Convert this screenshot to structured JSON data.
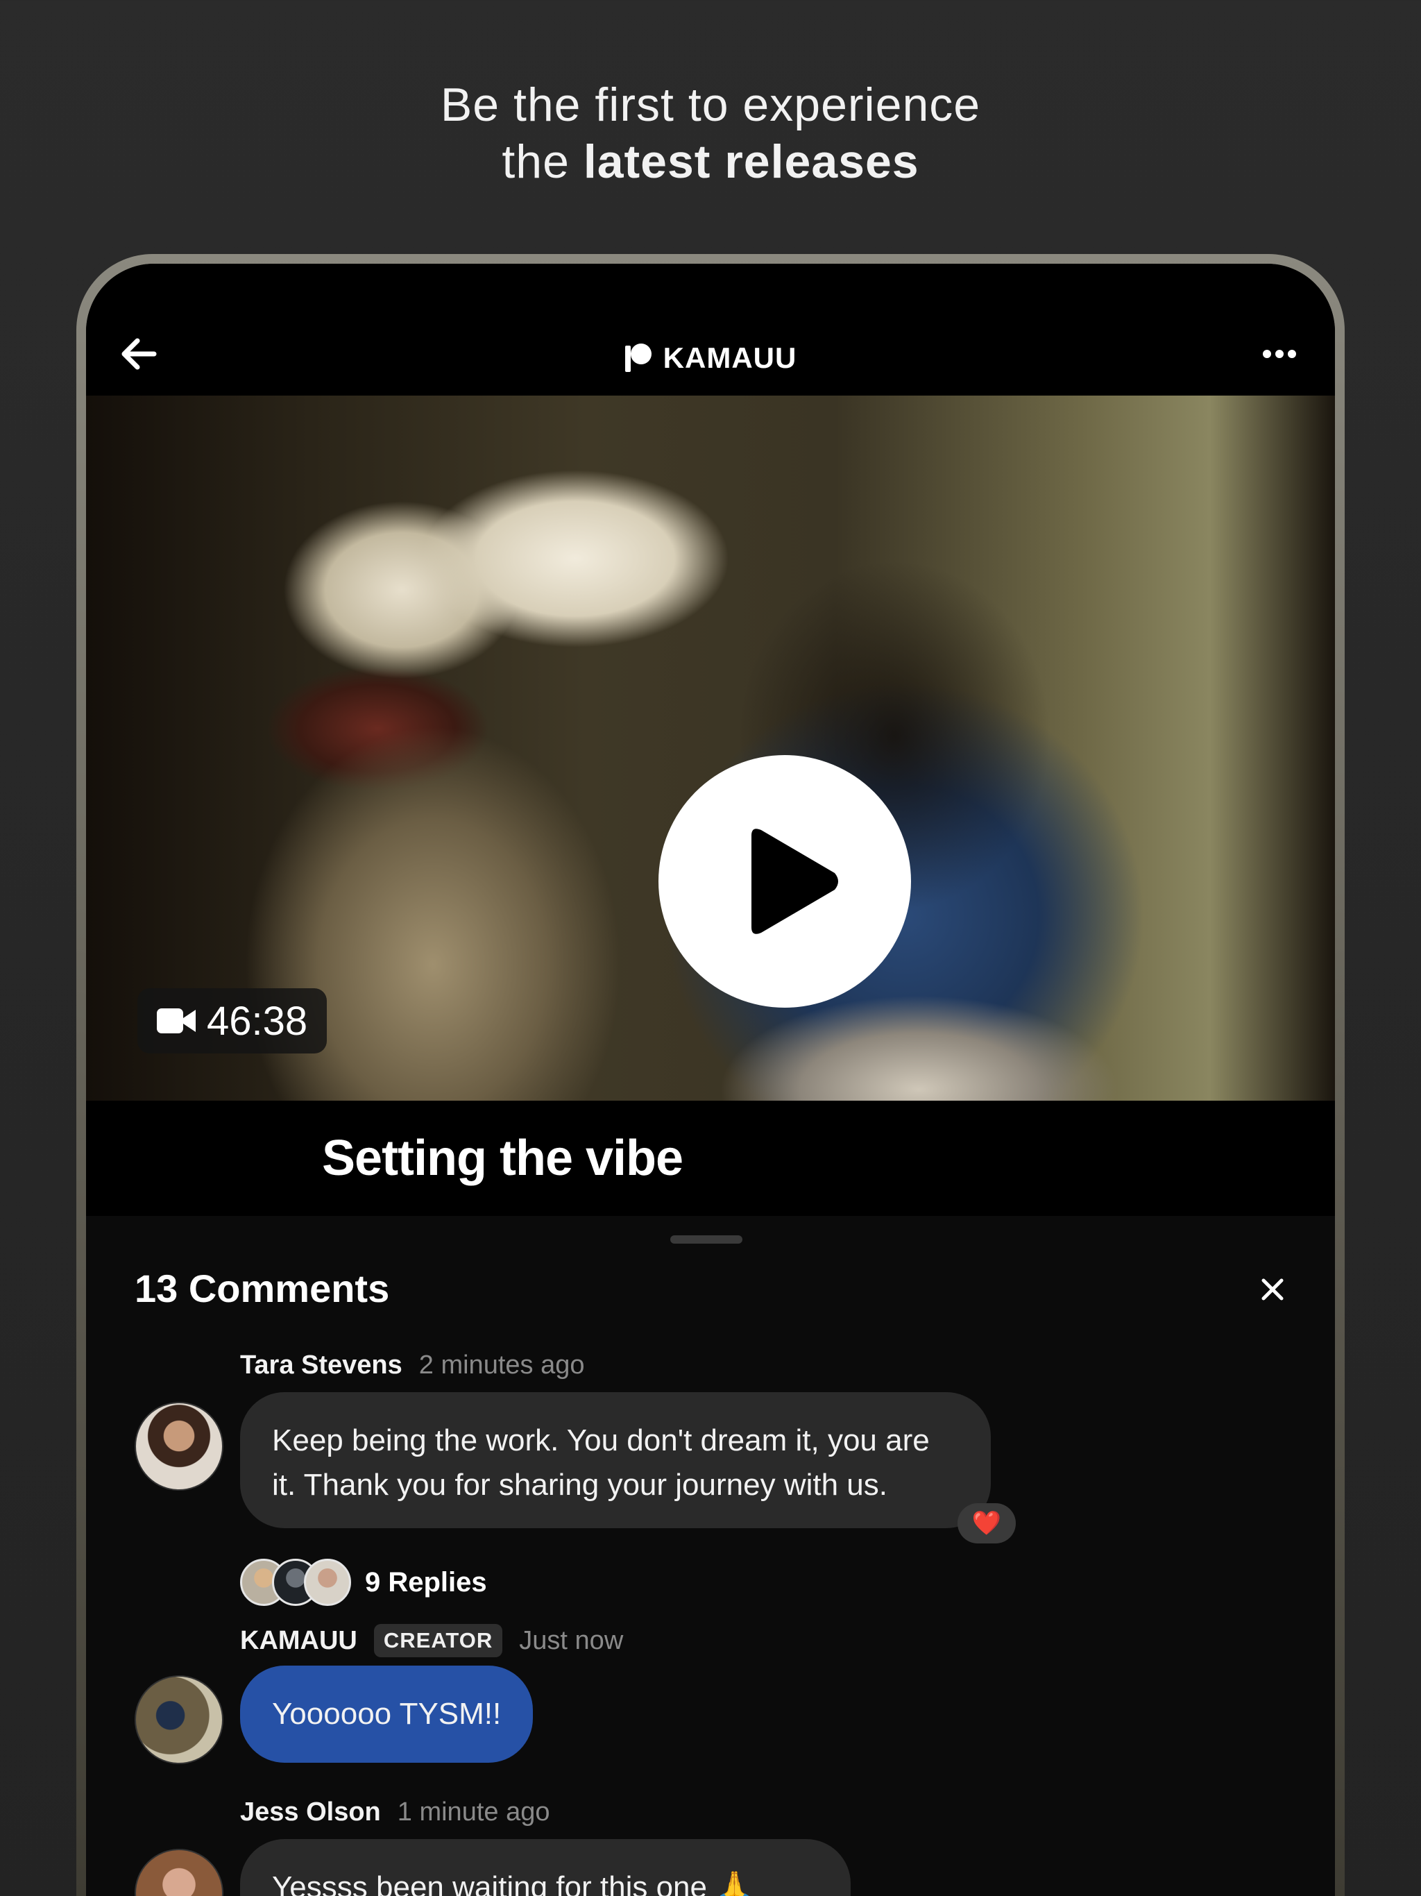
{
  "headline": {
    "line1": "Be the first to experience",
    "line2_prefix": "the ",
    "line2_bold": "latest releases"
  },
  "topbar": {
    "brand": "KAMAUU"
  },
  "video": {
    "duration": "46:38",
    "title": "Setting the vibe"
  },
  "comments": {
    "header": "13 Comments",
    "items": [
      {
        "author": "Tara Stevens",
        "time": "2 minutes ago",
        "text": "Keep being the work. You don't dream it, you are it. Thank you for sharing your journey with us.",
        "reaction": "❤️",
        "replies": "9 Replies"
      },
      {
        "author": "KAMAUU",
        "badge": "CREATOR",
        "time": "Just now",
        "text": "Yoooooo TYSM!!"
      },
      {
        "author": "Jess Olson",
        "time": "1 minute ago",
        "text": "Yessss been waiting for this one 🙏"
      }
    ]
  },
  "colors": {
    "background": "#262626",
    "creator_bubble": "#2651a6",
    "bubble": "#2a2a2a",
    "sheet": "#0b0b0b"
  }
}
